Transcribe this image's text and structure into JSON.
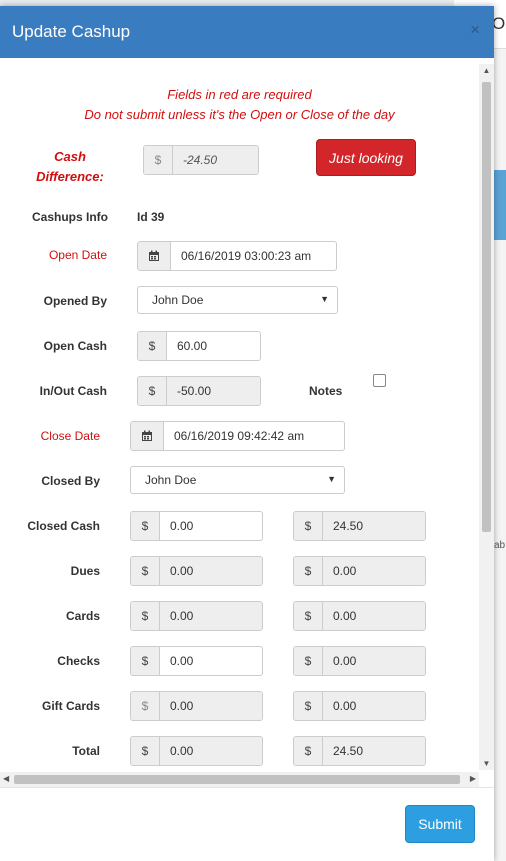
{
  "background": {
    "tab_text": "Op",
    "side_text": "ab"
  },
  "modal": {
    "title": "Update Cashup",
    "close_glyph": "×",
    "notice_line1": "Fields in red are required",
    "notice_line2": "Do not submit unless it's the Open or Close of the day",
    "cash_difference": {
      "label_line1": "Cash",
      "label_line2": "Difference:",
      "currency": "$",
      "value": "-24.50"
    },
    "just_looking_label": "Just looking",
    "cashups_info": {
      "label": "Cashups Info",
      "value": "Id 39"
    },
    "open_date": {
      "label": "Open Date",
      "value": "06/16/2019 03:00:23 am",
      "icon": "calendar-icon"
    },
    "opened_by": {
      "label": "Opened By",
      "value": "John Doe"
    },
    "open_cash": {
      "label": "Open Cash",
      "currency": "$",
      "value": "60.00"
    },
    "in_out_cash": {
      "label": "In/Out Cash",
      "currency": "$",
      "value": "-50.00"
    },
    "notes_label": "Notes",
    "close_date": {
      "label": "Close Date",
      "value": "06/16/2019 09:42:42 am",
      "icon": "calendar-icon"
    },
    "closed_by": {
      "label": "Closed By",
      "value": "John Doe"
    },
    "rows": [
      {
        "label": "Closed Cash",
        "currency": "$",
        "entered": "0.00",
        "expected": "24.50"
      },
      {
        "label": "Dues",
        "currency": "$",
        "entered": "0.00",
        "expected": "0.00"
      },
      {
        "label": "Cards",
        "currency": "$",
        "entered": "0.00",
        "expected": "0.00"
      },
      {
        "label": "Checks",
        "currency": "$",
        "entered": "0.00",
        "expected": "0.00"
      },
      {
        "label": "Gift Cards",
        "currency": "$",
        "entered": "0.00",
        "expected": "0.00"
      },
      {
        "label": "Total",
        "currency": "$",
        "entered": "0.00",
        "expected": "24.50"
      }
    ],
    "submit_label": "Submit"
  },
  "colors": {
    "header": "#3a7cc0",
    "required": "#d01010",
    "danger_button": "#d3262b",
    "submit_button": "#2d9fe0"
  }
}
